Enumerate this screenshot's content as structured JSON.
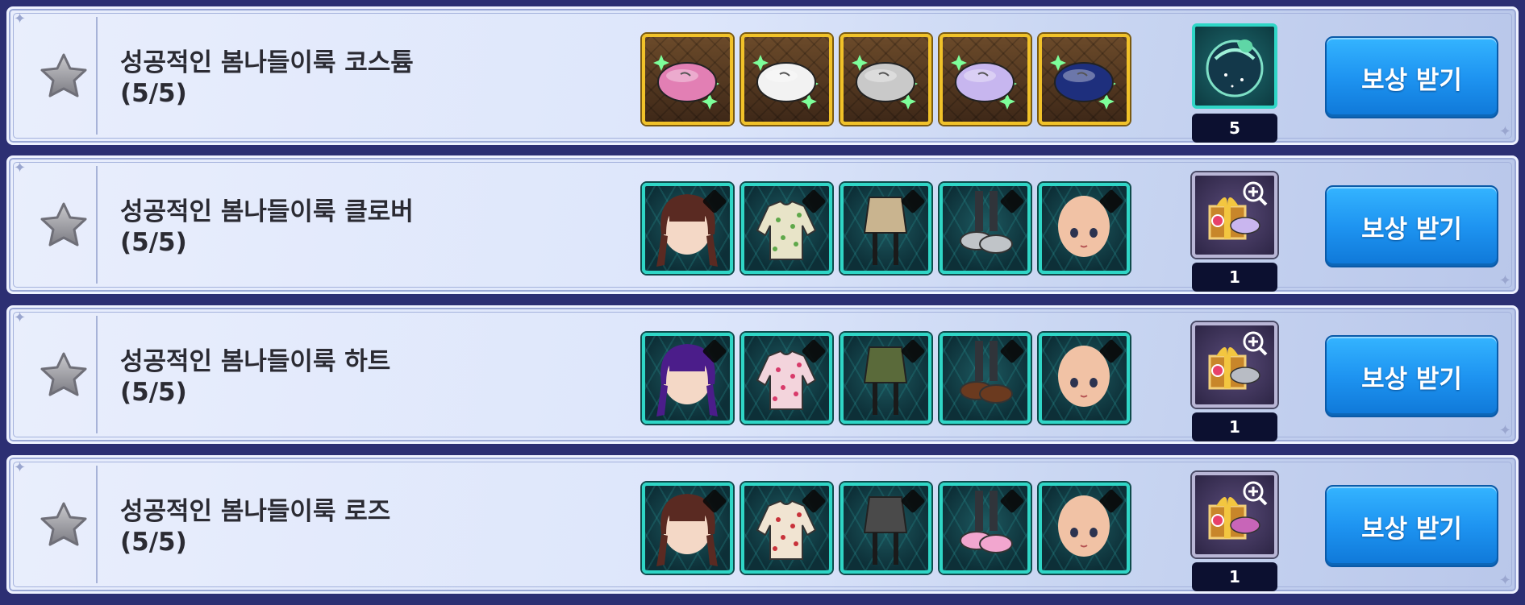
{
  "colors": {
    "button": "#1e94f1",
    "gold_frame": "#f1c229",
    "teal_frame": "#2fd6c6",
    "panel": "#dde6fb",
    "count_bg": "#0c1030"
  },
  "rows": [
    {
      "title": "성공적인 봄나들이룩 코스튬\n(5/5)",
      "item_frame": "gold",
      "items": [
        {
          "icon": "pink-beret-icon",
          "color": "#e27fb4"
        },
        {
          "icon": "white-beret-icon",
          "color": "#f2f2f2"
        },
        {
          "icon": "gray-beret-icon",
          "color": "#c9c9c9"
        },
        {
          "icon": "lavender-beret-icon",
          "color": "#c7b6ef"
        },
        {
          "icon": "navy-beret-icon",
          "color": "#1e2f7d"
        }
      ],
      "reward": {
        "icon": "space-orb-icon",
        "count": "5",
        "frame": "teal"
      },
      "button_label": "보상 받기"
    },
    {
      "title": "성공적인 봄나들이룩 클로버\n(5/5)",
      "item_frame": "teal",
      "items": [
        {
          "icon": "brown-hair-icon",
          "color": "#5a2a22"
        },
        {
          "icon": "floral-jacket-icon",
          "color": "#e8e4c8"
        },
        {
          "icon": "beige-skirt-icon",
          "color": "#c9b48f"
        },
        {
          "icon": "gray-shoes-icon",
          "color": "#c0c4c8"
        },
        {
          "icon": "face-icon",
          "color": "#f1c2a5"
        }
      ],
      "reward": {
        "icon": "gift-box-icon",
        "count": "1",
        "frame": "purple"
      },
      "button_label": "보상 받기"
    },
    {
      "title": "성공적인 봄나들이룩 하트\n(5/5)",
      "item_frame": "teal",
      "items": [
        {
          "icon": "purple-hair-icon",
          "color": "#4b1d8a"
        },
        {
          "icon": "heart-jacket-icon",
          "color": "#f3d4dc"
        },
        {
          "icon": "olive-skirt-icon",
          "color": "#5a6a3a"
        },
        {
          "icon": "brown-shoes-icon",
          "color": "#6b3a1f"
        },
        {
          "icon": "face-icon",
          "color": "#f1c2a5"
        }
      ],
      "reward": {
        "icon": "gift-box-icon",
        "count": "1",
        "frame": "purple"
      },
      "button_label": "보상 받기"
    },
    {
      "title": "성공적인 봄나들이룩 로즈\n(5/5)",
      "item_frame": "teal",
      "items": [
        {
          "icon": "brown-hair-icon",
          "color": "#5a2a22"
        },
        {
          "icon": "rose-jacket-icon",
          "color": "#f1e4d2"
        },
        {
          "icon": "gray-skirt-icon",
          "color": "#4a4a4a"
        },
        {
          "icon": "pink-shoes-icon",
          "color": "#f2a6cf"
        },
        {
          "icon": "face-icon",
          "color": "#f1c2a5"
        }
      ],
      "reward": {
        "icon": "gift-box-icon",
        "count": "1",
        "frame": "purple"
      },
      "button_label": "보상 받기"
    }
  ]
}
